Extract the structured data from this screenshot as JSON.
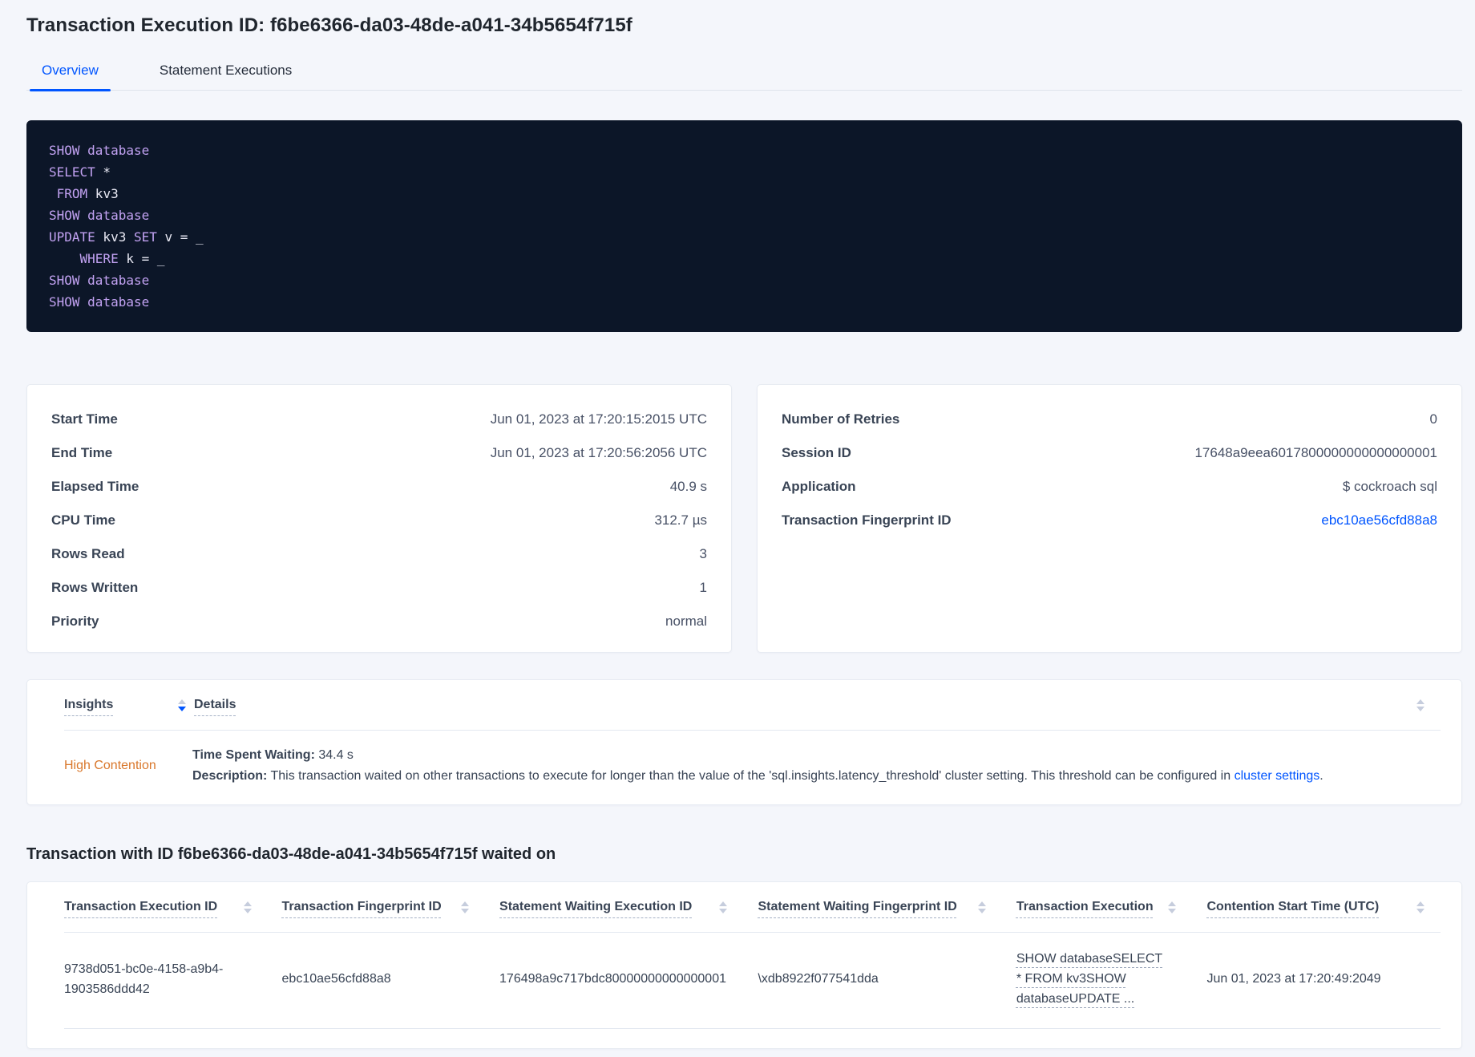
{
  "page": {
    "title": "Transaction Execution ID: f6be6366-da03-48de-a041-34b5654f715f",
    "tabs": [
      {
        "label": "Overview"
      },
      {
        "label": "Statement Executions"
      }
    ]
  },
  "colors": {
    "accent_blue": "#0055ff",
    "warning_orange": "#d9772b",
    "code_background": "#0c1628",
    "code_keyword": "#c2a2f2"
  },
  "sql": {
    "lines": [
      {
        "tokens": [
          {
            "text": "SHOW database"
          }
        ]
      },
      {
        "tokens": [
          {
            "text": "SELECT"
          },
          {
            "text": " *"
          }
        ]
      },
      {
        "tokens": [
          {
            "text": " FROM"
          },
          {
            "text": " kv3"
          }
        ]
      },
      {
        "tokens": [
          {
            "text": "SHOW database"
          }
        ]
      },
      {
        "tokens": [
          {
            "text": "UPDATE"
          },
          {
            "text": " kv3 "
          },
          {
            "text": "SET"
          },
          {
            "text": " v = _"
          }
        ]
      },
      {
        "tokens": [
          {
            "text": "    WHERE"
          },
          {
            "text": " k = _"
          }
        ]
      },
      {
        "tokens": [
          {
            "text": "SHOW database"
          }
        ]
      },
      {
        "tokens": [
          {
            "text": "SHOW database"
          }
        ]
      }
    ]
  },
  "stats_left": {
    "rows": [
      {
        "label": "Start Time",
        "value": "Jun 01, 2023 at 17:20:15:2015 UTC"
      },
      {
        "label": "End Time",
        "value": "Jun 01, 2023 at 17:20:56:2056 UTC"
      },
      {
        "label": "Elapsed Time",
        "value": "40.9 s"
      },
      {
        "label": "CPU Time",
        "value": "312.7 µs"
      },
      {
        "label": "Rows Read",
        "value": "3"
      },
      {
        "label": "Rows Written",
        "value": "1"
      },
      {
        "label": "Priority",
        "value": "normal"
      }
    ]
  },
  "stats_right": {
    "rows": [
      {
        "label": "Number of Retries",
        "value": "0"
      },
      {
        "label": "Session ID",
        "value": "17648a9eea6017800000000000000001"
      },
      {
        "label": "Application",
        "value": "$ cockroach sql"
      }
    ],
    "fingerprint": {
      "label": "Transaction Fingerprint ID",
      "value": "ebc10ae56cfd88a8"
    }
  },
  "insights_table": {
    "headers": {
      "insights": "Insights",
      "details": "Details"
    },
    "row": {
      "insight": "High Contention",
      "waiting_label": "Time Spent Waiting:",
      "waiting_value": " 34.4 s",
      "description_label": "Description:",
      "description_text": " This transaction waited on other transactions to execute for longer than the value of the 'sql.insights.latency_threshold' cluster setting. This threshold can be configured in ",
      "description_link": "cluster settings",
      "description_suffix": "."
    }
  },
  "waited_section": {
    "heading": "Transaction with ID f6be6366-da03-48de-a041-34b5654f715f waited on",
    "columns": [
      "Transaction Execution ID",
      "Transaction Fingerprint ID",
      "Statement Waiting Execution ID",
      "Statement Waiting Fingerprint ID",
      "Transaction Execution",
      "Contention Start Time (UTC)"
    ],
    "row": {
      "transaction_execution_id": "9738d051-bc0e-4158-a9b4-1903586ddd42",
      "transaction_fingerprint_id": "ebc10ae56cfd88a8",
      "statement_waiting_execution_id": "176498a9c717bdc80000000000000001",
      "statement_waiting_fingerprint_id": "\\xdb8922f077541dda",
      "transaction_execution": "SHOW databaseSELECT * FROM kv3SHOW databaseUPDATE ...",
      "contention_start_time": "Jun 01, 2023 at 17:20:49:2049"
    }
  }
}
